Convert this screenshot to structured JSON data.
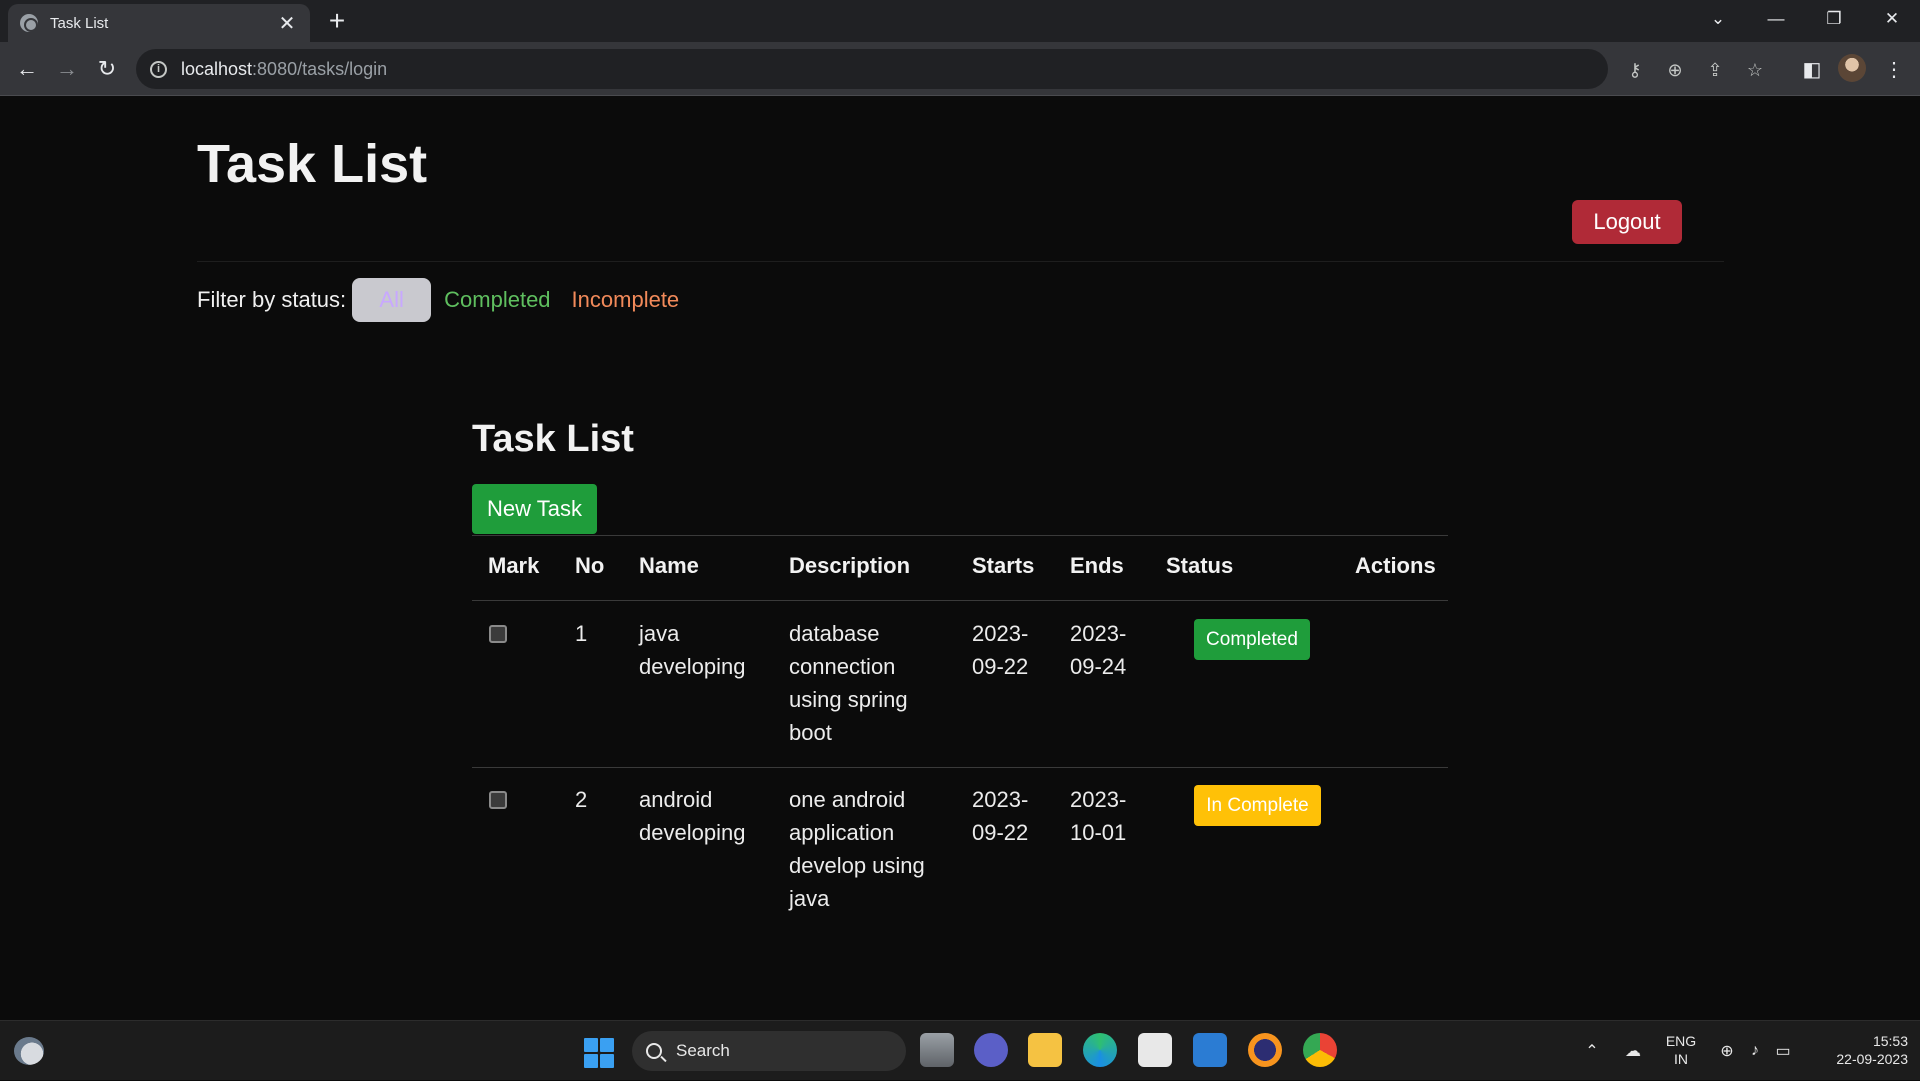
{
  "browser": {
    "tab_title": "Task List",
    "tab_close": "✕",
    "new_tab": "+",
    "url_host": "localhost",
    "url_path": ":8080/tasks/login"
  },
  "page": {
    "title": "Task List",
    "logout_label": "Logout",
    "filter": {
      "label": "Filter by status:",
      "options": [
        "All",
        "Completed",
        "Incomplete"
      ],
      "selected": "All"
    },
    "list_title": "Task List",
    "new_task_label": "New Task",
    "table": {
      "headers": [
        "Mark",
        "No",
        "Name",
        "Description",
        "Starts",
        "Ends",
        "Status",
        "Actions"
      ],
      "rows": [
        {
          "no": "1",
          "name": [
            "java",
            "developing"
          ],
          "description": [
            "database",
            "connection",
            "using spring",
            "boot"
          ],
          "starts": [
            "2023-",
            "09-22"
          ],
          "ends": [
            "2023-",
            "09-24"
          ],
          "status": "Completed"
        },
        {
          "no": "2",
          "name": [
            "android",
            "developing"
          ],
          "description": [
            "one android",
            "application",
            "develop using",
            "java"
          ],
          "starts": [
            "2023-",
            "09-22"
          ],
          "ends": [
            "2023-",
            "10-01"
          ],
          "status": "In Complete"
        }
      ]
    }
  },
  "taskbar": {
    "search_placeholder": "Search",
    "lang_line1": "ENG",
    "lang_line2": "IN",
    "time": "15:53",
    "date": "22-09-2023"
  },
  "colors": {
    "logout": "#b02a37",
    "success": "#1f9d3b",
    "warning": "#ffc107",
    "filter_completed": "#5fbf5f",
    "filter_incomplete": "#f28a5a"
  }
}
